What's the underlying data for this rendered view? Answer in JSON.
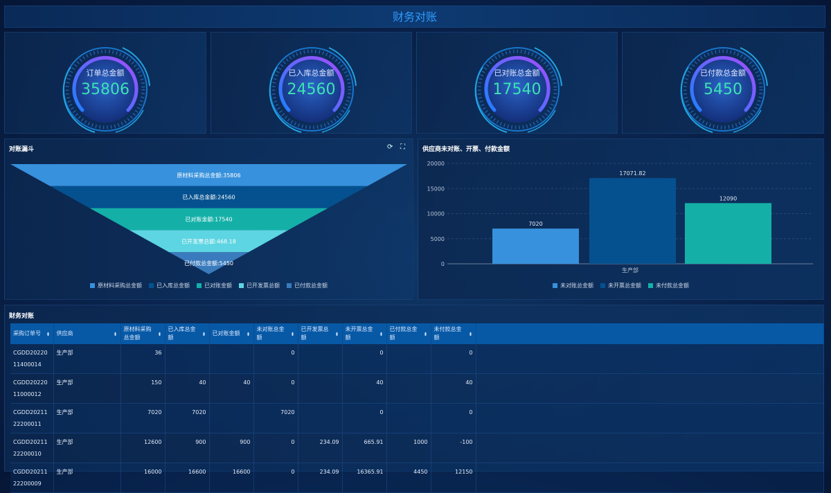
{
  "header": {
    "title": "财务对账"
  },
  "cards": [
    {
      "label": "订单总金额",
      "value": "35806"
    },
    {
      "label": "已入库总金额",
      "value": "24560"
    },
    {
      "label": "已对账总金额",
      "value": "17540"
    },
    {
      "label": "已付款总金额",
      "value": "5450"
    }
  ],
  "funnel": {
    "title": "对账漏斗",
    "refresh_icon": "refresh-icon",
    "fullscreen_icon": "fullscreen-icon"
  },
  "bar": {
    "title": "供应商未对账、开票、付款金额"
  },
  "chart_data": [
    {
      "type": "funnel",
      "title": "对账漏斗",
      "categories": [
        "原材料采购总金额",
        "已入库总金额",
        "已对账金额",
        "已开发票总额",
        "已付款总金额"
      ],
      "values": [
        35806,
        24560,
        17540,
        468.18,
        5450
      ],
      "labels": [
        "原材料采购总金额:35806",
        "已入库总金额:24560",
        "已对账金额:17540",
        "已开发票总额:468.18",
        "已付款总金额:5450"
      ],
      "colors": [
        "#3791dc",
        "#05518f",
        "#14b0a8",
        "#5dd5e2",
        "#3a7bbd"
      ],
      "legend": "bottom"
    },
    {
      "type": "bar",
      "title": "供应商未对账、开票、付款金额",
      "categories": [
        "生产部"
      ],
      "series": [
        {
          "name": "未对账总金额",
          "values": [
            7020
          ],
          "color": "#3791dc"
        },
        {
          "name": "未开票总金额",
          "values": [
            17071.82
          ],
          "color": "#05518f"
        },
        {
          "name": "未付款总金额",
          "values": [
            12090
          ],
          "color": "#14b0a8"
        }
      ],
      "value_labels": [
        "7020",
        "17071.82",
        "12090"
      ],
      "yticks": [
        "0",
        "5000",
        "10000",
        "15000",
        "20000"
      ],
      "ylim": [
        0,
        20000
      ],
      "grid": true,
      "legend": "bottom"
    }
  ],
  "table": {
    "title": "财务对账",
    "columns": [
      "采购订单号",
      "供应商",
      "原材料采购总金额",
      "已入库总金额",
      "已对账金额",
      "未对账总金额",
      "已开发票总额",
      "未开票总金额",
      "已付款总金额",
      "未付款总金额"
    ],
    "rows": [
      [
        "CGDD2022011400014",
        "生产部",
        "36",
        "",
        "",
        "0",
        "",
        "0",
        "",
        "0"
      ],
      [
        "CGDD2022011000012",
        "生产部",
        "150",
        "40",
        "40",
        "0",
        "",
        "40",
        "",
        "40"
      ],
      [
        "CGDD2021122200011",
        "生产部",
        "7020",
        "7020",
        "",
        "7020",
        "",
        "0",
        "",
        "0"
      ],
      [
        "CGDD2021122200010",
        "生产部",
        "12600",
        "900",
        "900",
        "0",
        "234.09",
        "665.91",
        "1000",
        "-100"
      ],
      [
        "CGDD2021122200009",
        "生产部",
        "16000",
        "16600",
        "16600",
        "0",
        "234.09",
        "16365.91",
        "4450",
        "12150"
      ]
    ]
  }
}
